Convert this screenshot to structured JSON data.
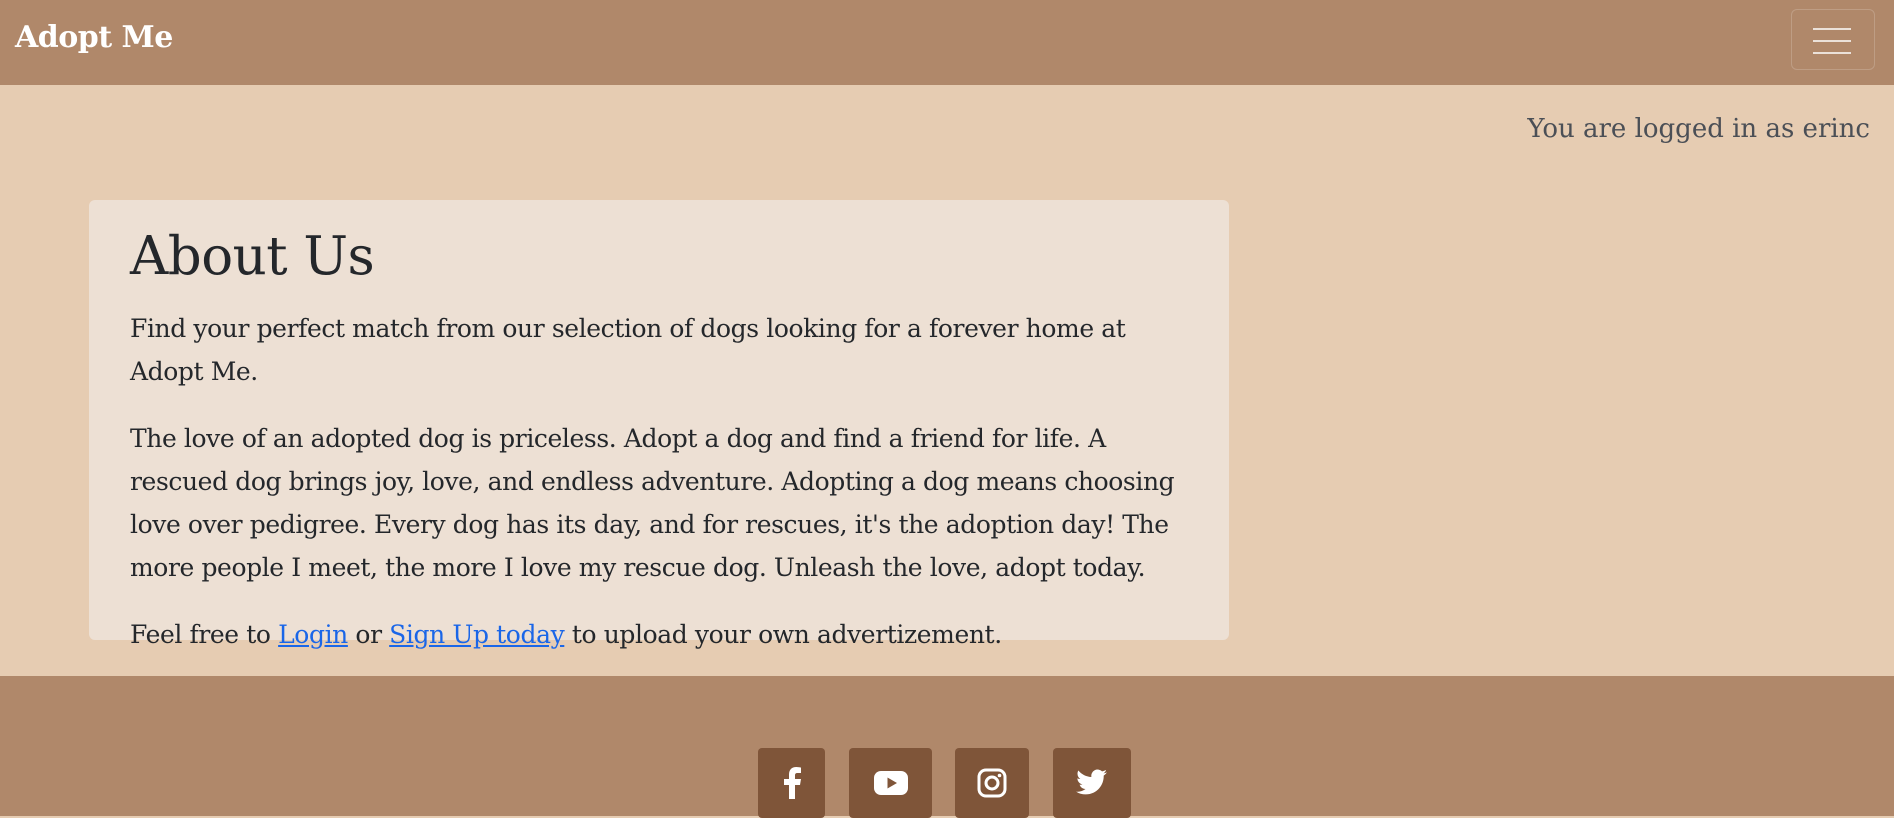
{
  "navbar": {
    "brand": "Adopt Me",
    "toggler_icon": "hamburger-menu-icon"
  },
  "status": {
    "logged_in_text": "You are logged in as erinc"
  },
  "about": {
    "title": "About Us",
    "intro": "Find your perfect match from our selection of dogs looking for a forever home at Adopt Me.",
    "body": "The love of an adopted dog is priceless. Adopt a dog and find a friend for life. A rescued dog brings joy, love, and endless adventure. Adopting a dog means choosing love over pedigree. Every dog has its day, and for rescues, it's the adoption day! The more people I meet, the more I love my rescue dog. Unleash the love, adopt today.",
    "cta_prefix": "Feel free to ",
    "login_link": "Login",
    "cta_or": " or ",
    "signup_link": "Sign Up today",
    "cta_suffix": " to upload your own advertizement."
  },
  "footer": {
    "social": [
      {
        "name": "facebook",
        "icon": "facebook-icon"
      },
      {
        "name": "youtube",
        "icon": "youtube-icon"
      },
      {
        "name": "instagram",
        "icon": "instagram-icon"
      },
      {
        "name": "twitter",
        "icon": "twitter-icon"
      }
    ]
  },
  "colors": {
    "navbar_bg": "#b0886a",
    "page_bg": "#e6ccb2",
    "card_bg": "#ede0d4",
    "social_button_bg": "#7f5539",
    "link": "#1a66e8"
  }
}
